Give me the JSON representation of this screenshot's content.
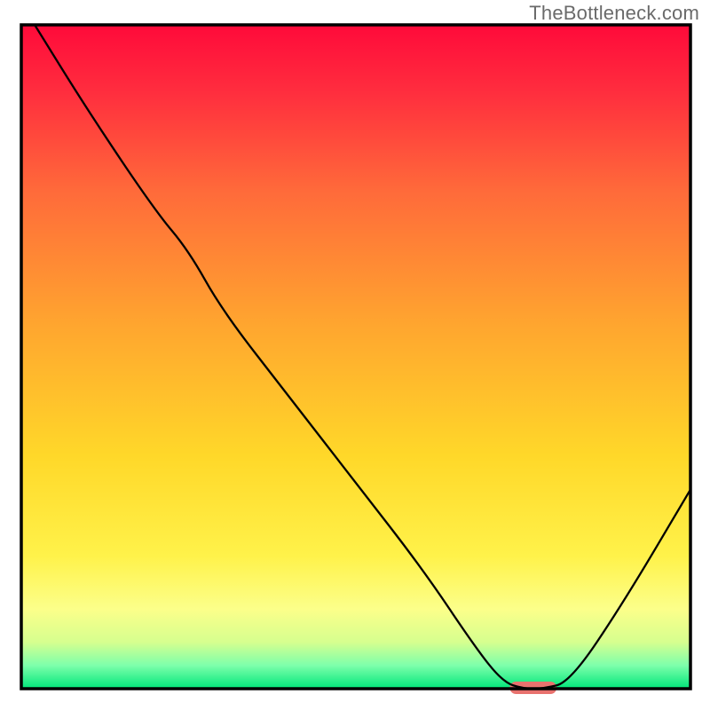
{
  "watermark": "TheBottleneck.com",
  "chart_data": {
    "type": "line",
    "title": "",
    "xlabel": "",
    "ylabel": "",
    "xlim": [
      0,
      100
    ],
    "ylim": [
      0,
      100
    ],
    "series": [
      {
        "name": "bottleneck-curve",
        "x": [
          2,
          10,
          20,
          25,
          30,
          40,
          50,
          60,
          68,
          72,
          75,
          78,
          82,
          90,
          100
        ],
        "values": [
          100,
          87,
          72,
          66,
          57,
          44,
          31,
          18,
          6,
          1,
          0,
          0,
          1,
          13,
          30
        ]
      }
    ],
    "marker": {
      "name": "optimal-marker",
      "x_start": 73,
      "x_end": 80,
      "y": 0,
      "color": "#e8726e"
    },
    "background_gradient": {
      "stops": [
        {
          "offset": 0.0,
          "color": "#ff0a3a"
        },
        {
          "offset": 0.1,
          "color": "#ff2d3e"
        },
        {
          "offset": 0.25,
          "color": "#ff6a3a"
        },
        {
          "offset": 0.45,
          "color": "#ffa52f"
        },
        {
          "offset": 0.65,
          "color": "#ffd829"
        },
        {
          "offset": 0.8,
          "color": "#fff24a"
        },
        {
          "offset": 0.88,
          "color": "#fcff8a"
        },
        {
          "offset": 0.93,
          "color": "#d6ff8f"
        },
        {
          "offset": 0.965,
          "color": "#7dffab"
        },
        {
          "offset": 1.0,
          "color": "#00e67a"
        }
      ]
    },
    "frame_color": "#000000",
    "line_color": "#000000",
    "line_width": 2.3
  }
}
